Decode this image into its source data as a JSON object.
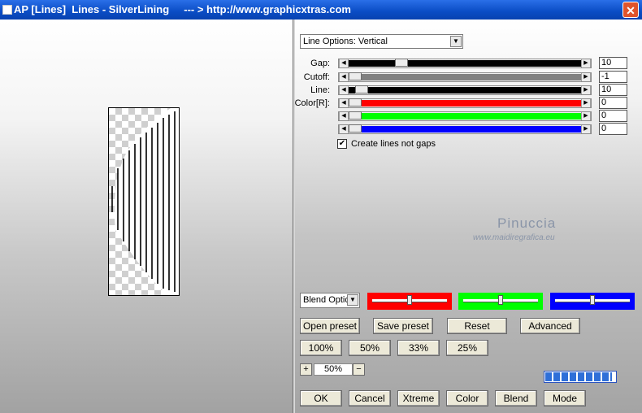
{
  "window": {
    "title": "AP [Lines]  Lines - SilverLining     --- > http://www.graphicxtras.com",
    "close_label": "✕"
  },
  "line_options": {
    "selected": "Line Options: Vertical"
  },
  "sliders": [
    {
      "label": "Gap:",
      "value": "10",
      "fraction": 0.21,
      "color": "#000000"
    },
    {
      "label": "Cutoff:",
      "value": "-1",
      "fraction": 0.0,
      "color": "#808080"
    },
    {
      "label": "Line:",
      "value": "10",
      "fraction": 0.03,
      "color": "#000000"
    },
    {
      "label": "Color[R]:",
      "value": "0",
      "fraction": 0.0,
      "color": "#ff0000"
    },
    {
      "label": "",
      "value": "0",
      "fraction": 0.0,
      "color": "#00ff00"
    },
    {
      "label": "",
      "value": "0",
      "fraction": 0.0,
      "color": "#0000ff"
    }
  ],
  "checkbox": {
    "label": "Create lines not gaps",
    "checked": true
  },
  "watermark": {
    "name": "Pinuccia",
    "site": "www.maidiregrafica.eu"
  },
  "blend": {
    "selected": "Blend Optio"
  },
  "color_boxes": [
    {
      "color": "#ff0000",
      "level": 0.5
    },
    {
      "color": "#00ff00",
      "level": 0.5
    },
    {
      "color": "#0000ff",
      "level": 0.5
    }
  ],
  "buttons": {
    "open_preset": "Open preset",
    "save_preset": "Save preset",
    "reset": "Reset",
    "advanced": "Advanced",
    "zoom_100": "100%",
    "zoom_50": "50%",
    "zoom_33": "33%",
    "zoom_25": "25%",
    "ok": "OK",
    "cancel": "Cancel",
    "xtreme": "Xtreme",
    "color": "Color",
    "blend": "Blend",
    "mode": "Mode"
  },
  "zoom": {
    "plus": "+",
    "minus": "−",
    "value": "50%"
  },
  "progress": {
    "fraction": 0.95
  }
}
